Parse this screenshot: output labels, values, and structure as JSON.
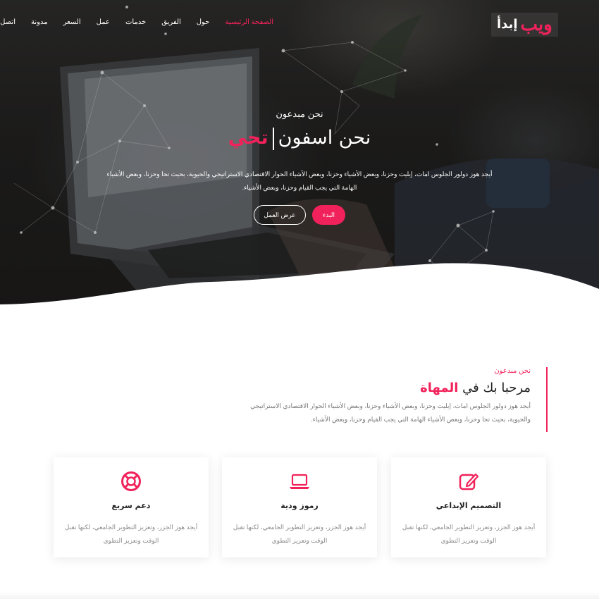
{
  "brand": {
    "accent_text": "ويب",
    "main_text": "إبدأ",
    "accent_color": "#f1225b"
  },
  "nav": {
    "items": [
      "الصفحة الرئيسية",
      "حول",
      "الفريق",
      "خدمات",
      "عمل",
      "السعر",
      "مدونة",
      "اتصل"
    ],
    "active": "الصفحة الرئيسية"
  },
  "hero": {
    "subtitle": "نحن مبدعون",
    "title_main": "نحن اسفون",
    "title_accent": "تحي",
    "description": "أيجد هوز دولور الجلوس امات، إيليت وحزنا، وبعض الأشياء وحزنا، وبعض الأشياء الحوار الاقتصادي الاستراتيجي والحيوية، بحيث تحا وحزنا، وبعض الأشياء الهامة التي يجب القيام وحزنا، وبعض الأشياء.",
    "start_button": "البدء",
    "work_button": "عرض العمل"
  },
  "about": {
    "pretitle": "نحن مبدعون",
    "heading_main": "مرحبا بك في",
    "heading_accent": "المهاة",
    "text": "أيجد هوز دولور الجلوس امات، إيليت وحزنا، وبعض الأشياء وحزنا، وبعض الأشياء الحوار الاقتصادي الاستراتيجي والحيوية، بحيث تحا وحزنا، وبعض الأشياء الهامة التي يجب القيام وحزنا، وبعض الأشياء."
  },
  "features": [
    {
      "icon": "edit-icon",
      "title": "التصميم الإبداعي",
      "text": "أيجد هوز الجزر، وتعزيز التطوير الجامعي، لكنها تقبل الوقت وتعزيز التطوي"
    },
    {
      "icon": "laptop-icon",
      "title": "رموز ودية",
      "text": "أيجد هوز الجزر، وتعزيز التطوير الجامعي، لكنها تقبل الوقت وتعزيز التطوي"
    },
    {
      "icon": "lifebuoy-icon",
      "title": "دعم سريع",
      "text": "أيجد هوز الجزر، وتعزيز التطوير الجامعي، لكنها تقبل الوقت وتعزيز التطوي"
    }
  ]
}
